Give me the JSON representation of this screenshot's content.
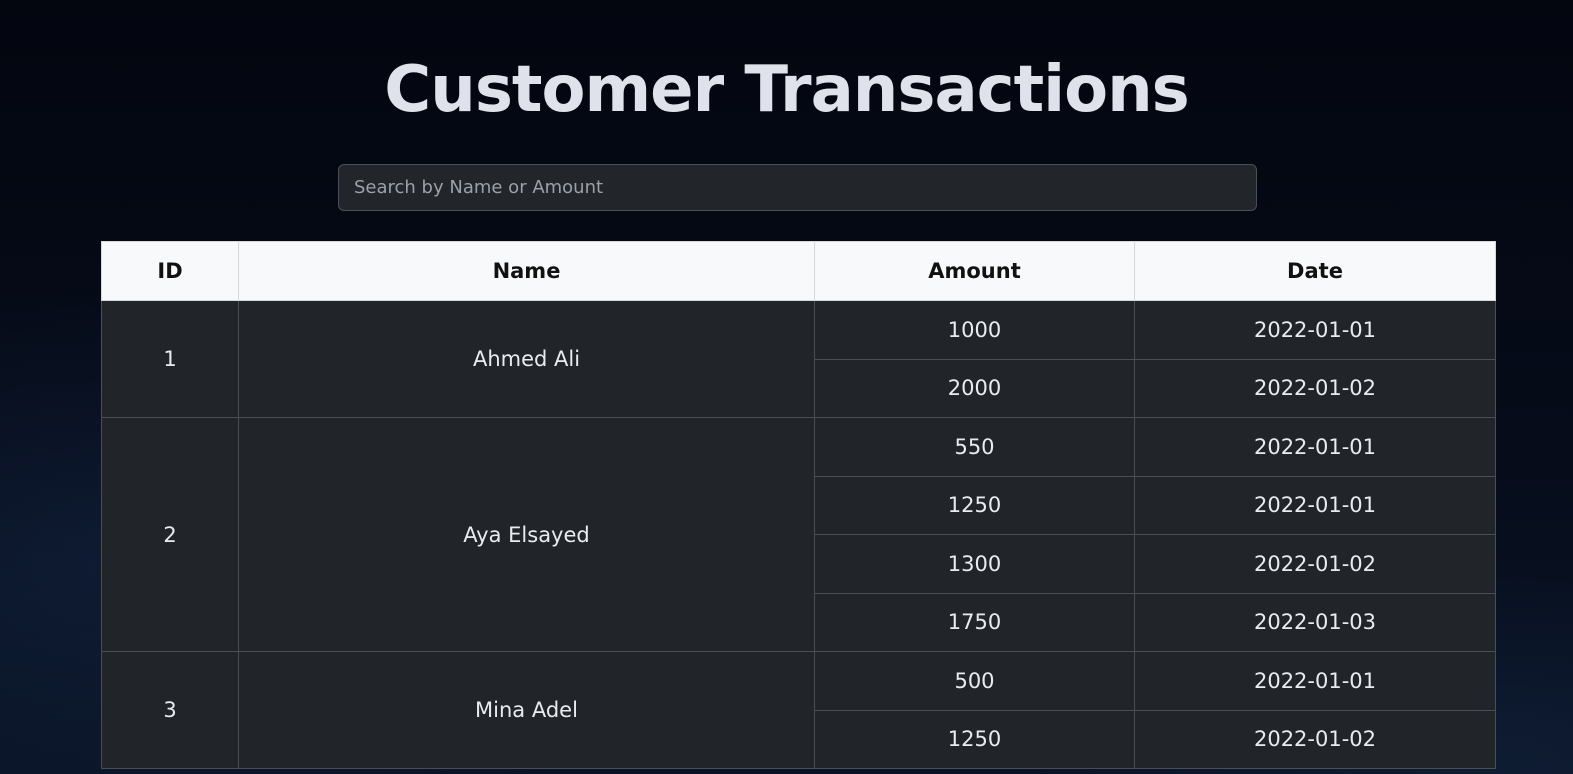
{
  "title": "Customer Transactions",
  "search": {
    "placeholder": "Search by Name or Amount",
    "value": ""
  },
  "table": {
    "headers": [
      "ID",
      "Name",
      "Amount",
      "Date"
    ],
    "customers": [
      {
        "id": "1",
        "name": "Ahmed Ali",
        "transactions": [
          {
            "amount": "1000",
            "date": "2022-01-01"
          },
          {
            "amount": "2000",
            "date": "2022-01-02"
          }
        ]
      },
      {
        "id": "2",
        "name": "Aya Elsayed",
        "transactions": [
          {
            "amount": "550",
            "date": "2022-01-01"
          },
          {
            "amount": "1250",
            "date": "2022-01-01"
          },
          {
            "amount": "1300",
            "date": "2022-01-02"
          },
          {
            "amount": "1750",
            "date": "2022-01-03"
          }
        ]
      },
      {
        "id": "3",
        "name": "Mina Adel",
        "transactions": [
          {
            "amount": "500",
            "date": "2022-01-01"
          },
          {
            "amount": "1250",
            "date": "2022-01-02"
          }
        ]
      }
    ]
  }
}
